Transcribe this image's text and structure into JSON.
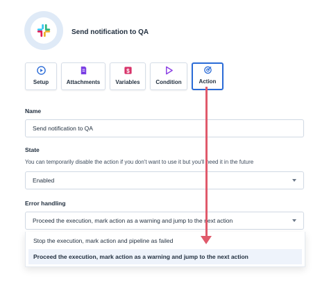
{
  "header": {
    "title": "Send notification to QA",
    "app_icon": "slack-icon"
  },
  "tabs": [
    {
      "label": "Setup",
      "icon": "play-circle-icon",
      "color": "#2a6bd7"
    },
    {
      "label": "Attachments",
      "icon": "file-icon",
      "color": "#7b3fe4"
    },
    {
      "label": "Variables",
      "icon": "dollar-icon",
      "color": "#d8336a"
    },
    {
      "label": "Condition",
      "icon": "play-triangle-icon",
      "color": "#8a3fe4"
    },
    {
      "label": "Action",
      "icon": "target-icon",
      "color": "#2a6bd7",
      "active": true
    }
  ],
  "form": {
    "name_label": "Name",
    "name_value": "Send notification to QA",
    "state_label": "State",
    "state_help": "You can temporarily disable the action if you don't want to use it but you'll need it in the future",
    "state_value": "Enabled",
    "error_label": "Error handling",
    "error_value": "Proceed the execution, mark action as a warning and jump to the next action",
    "error_options": [
      "Stop the execution, mark action and pipeline as failed",
      "Proceed the execution, mark action as a warning and jump to the next action"
    ]
  },
  "colors": {
    "accent": "#2a6bd7",
    "annotation": "#e05a6b"
  }
}
